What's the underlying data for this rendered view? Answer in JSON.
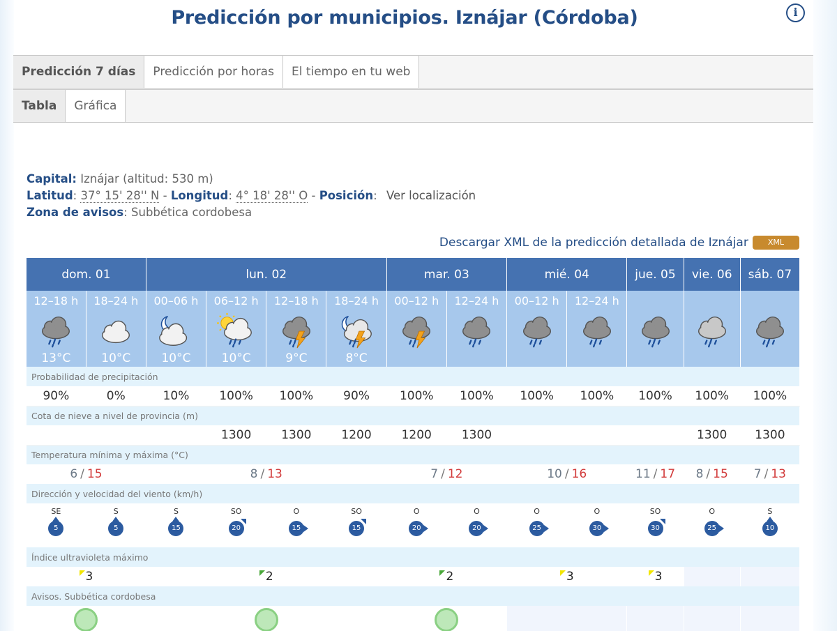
{
  "title": "Predicción por municipios. Iznájar (Córdoba)",
  "info_icon": "info-icon",
  "tabs_main": [
    {
      "label": "Predicción 7 días",
      "active": true
    },
    {
      "label": "Predicción por horas",
      "active": false
    },
    {
      "label": "El tiempo en tu web",
      "active": false
    }
  ],
  "tabs_sub": [
    {
      "label": "Tabla",
      "active": true
    },
    {
      "label": "Gráfica",
      "active": false
    }
  ],
  "meta": {
    "capital_label": "Capital:",
    "capital_value": "Iznájar (altitud: 530 m)",
    "lat_label": "Latitud",
    "lat_value": "37° 15' 28'' N",
    "lon_label": "Longitud",
    "lon_value": "4° 18' 28'' O",
    "pos_label": "Posición",
    "pos_link": "Ver localización",
    "zone_label": "Zona de avisos",
    "zone_value": "Subbética cordobesa"
  },
  "download": {
    "text": "Descargar XML de la predicción detallada de Iznájar",
    "badge": "XML"
  },
  "days": [
    {
      "label": "dom. 01"
    },
    {
      "label": "lun. 02"
    },
    {
      "label": "mar. 03"
    },
    {
      "label": "mié. 04"
    },
    {
      "label": "jue. 05"
    },
    {
      "label": "vie. 06"
    },
    {
      "label": "sáb. 07"
    }
  ],
  "periods": [
    {
      "hours": "12–18 h",
      "icon": "rain-cloud-icon",
      "temp": "13°C"
    },
    {
      "hours": "18–24 h",
      "icon": "cloud-icon",
      "temp": "10°C"
    },
    {
      "hours": "00–06 h",
      "icon": "moon-cloud-icon",
      "temp": "10°C"
    },
    {
      "hours": "06–12 h",
      "icon": "sun-cloud-rain-icon",
      "temp": "10°C"
    },
    {
      "hours": "12–18 h",
      "icon": "storm-rain-icon",
      "temp": "9°C"
    },
    {
      "hours": "18–24 h",
      "icon": "moon-storm-icon",
      "temp": "8°C"
    },
    {
      "hours": "00–12 h",
      "icon": "storm-rain-icon",
      "temp": ""
    },
    {
      "hours": "12–24 h",
      "icon": "rain-cloud-icon",
      "temp": ""
    },
    {
      "hours": "00–12 h",
      "icon": "rain-cloud-icon",
      "temp": ""
    },
    {
      "hours": "12–24 h",
      "icon": "rain-cloud-icon",
      "temp": ""
    },
    {
      "hours": "",
      "icon": "rain-cloud-icon",
      "temp": ""
    },
    {
      "hours": "",
      "icon": "light-rain-cloud-icon",
      "temp": ""
    },
    {
      "hours": "",
      "icon": "rain-cloud-icon",
      "temp": ""
    }
  ],
  "labels": {
    "precip": "Probabilidad de precipitación",
    "snow": "Cota de nieve a nivel de provincia (m)",
    "temp": "Temperatura mínima y máxima (°C)",
    "wind": "Dirección y velocidad del viento (km/h)",
    "uv": "Índice ultravioleta máximo",
    "warnings": "Avisos. Subbética cordobesa"
  },
  "precip": [
    "90%",
    "0%",
    "10%",
    "100%",
    "100%",
    "90%",
    "100%",
    "100%",
    "100%",
    "100%",
    "100%",
    "100%",
    "100%"
  ],
  "snow": [
    "",
    "",
    "",
    "1300",
    "1300",
    "1200",
    "1200",
    "1300",
    "",
    "",
    "",
    "1300",
    "1300"
  ],
  "temps": [
    {
      "min": "6",
      "max": "15"
    },
    {
      "min": "8",
      "max": "13"
    },
    {
      "min": "7",
      "max": "12"
    },
    {
      "min": "10",
      "max": "16"
    },
    {
      "min": "11",
      "max": "17"
    },
    {
      "min": "8",
      "max": "15"
    },
    {
      "min": "7",
      "max": "13"
    }
  ],
  "wind": [
    {
      "dir": "SE",
      "speed": "5"
    },
    {
      "dir": "S",
      "speed": "5"
    },
    {
      "dir": "S",
      "speed": "15"
    },
    {
      "dir": "SO",
      "speed": "20"
    },
    {
      "dir": "O",
      "speed": "15"
    },
    {
      "dir": "SO",
      "speed": "15"
    },
    {
      "dir": "O",
      "speed": "20"
    },
    {
      "dir": "O",
      "speed": "20"
    },
    {
      "dir": "O",
      "speed": "25"
    },
    {
      "dir": "O",
      "speed": "30"
    },
    {
      "dir": "SO",
      "speed": "30"
    },
    {
      "dir": "O",
      "speed": "25"
    },
    {
      "dir": "S",
      "speed": "10"
    }
  ],
  "uv": [
    {
      "value": "3",
      "color": "#f2e600"
    },
    {
      "value": "2",
      "color": "#4aa83a"
    },
    {
      "value": "2",
      "color": "#4aa83a"
    },
    {
      "value": "3",
      "color": "#f2e600"
    },
    {
      "value": "3",
      "color": "#f2e600"
    },
    {
      "value": "",
      "color": ""
    },
    {
      "value": "",
      "color": ""
    }
  ],
  "warning_level_color": "#8ad083"
}
